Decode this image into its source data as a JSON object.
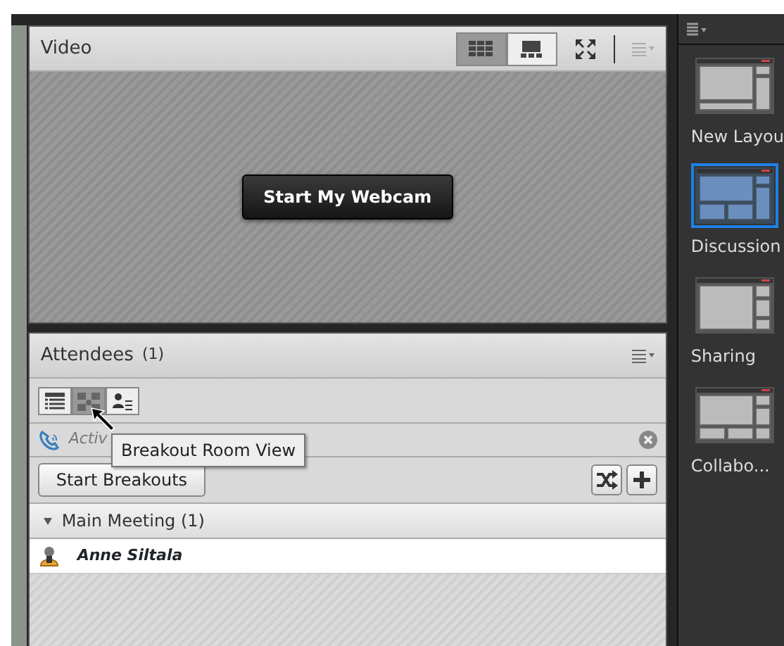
{
  "video": {
    "title": "Video",
    "view_buttons": [
      {
        "kind": "grid",
        "selected": true
      },
      {
        "kind": "single",
        "selected": false
      }
    ],
    "webcam_button": "Start My Webcam"
  },
  "attendees": {
    "title": "Attendees",
    "count": "(1)",
    "views": [
      {
        "kind": "list",
        "selected": false
      },
      {
        "kind": "breakout",
        "selected": true
      },
      {
        "kind": "presenter",
        "selected": false
      }
    ],
    "status": "Activ",
    "tooltip": "Breakout Room View",
    "start_button": "Start Breakouts",
    "group": {
      "label": "Main Meeting (1)",
      "expanded": true,
      "members": [
        {
          "name": "Anne Siltala"
        }
      ]
    }
  },
  "layouts": [
    {
      "kind": "new",
      "label": "New Layou",
      "selected": false
    },
    {
      "kind": "discussion",
      "label": "Discussion",
      "selected": true
    },
    {
      "kind": "sharing",
      "label": "Sharing",
      "selected": false
    },
    {
      "kind": "collaboration",
      "label": "Collabo...",
      "selected": false
    }
  ]
}
